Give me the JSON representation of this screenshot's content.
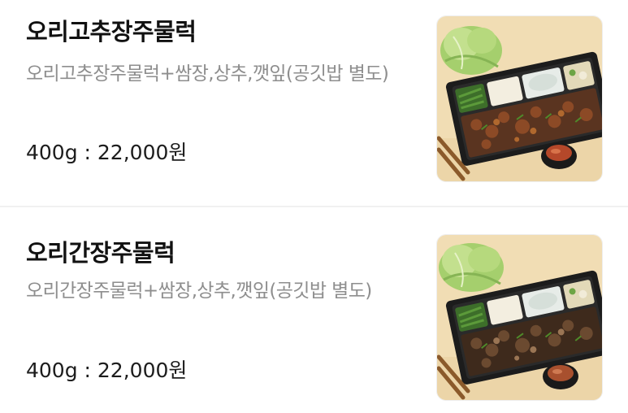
{
  "items": [
    {
      "name": "오리고추장주물럭",
      "description": "오리고추장주물럭+쌈장,상추,깻잎(공깃밥 별도)",
      "price": "400g : 22,000원",
      "image_icon": "duck-bulgogi-spicy-lunchbox-photo"
    },
    {
      "name": "오리간장주물럭",
      "description": "오리간장주물럭+쌈장,상추,깻잎(공깃밥 별도)",
      "price": "400g : 22,000원",
      "image_icon": "duck-bulgogi-soy-lunchbox-photo"
    }
  ],
  "colors": {
    "title": "#111111",
    "description": "#8e8e8e",
    "price": "#1c1c1c",
    "divider": "#f1f1f1",
    "photo_background": "#f1ddb4"
  }
}
